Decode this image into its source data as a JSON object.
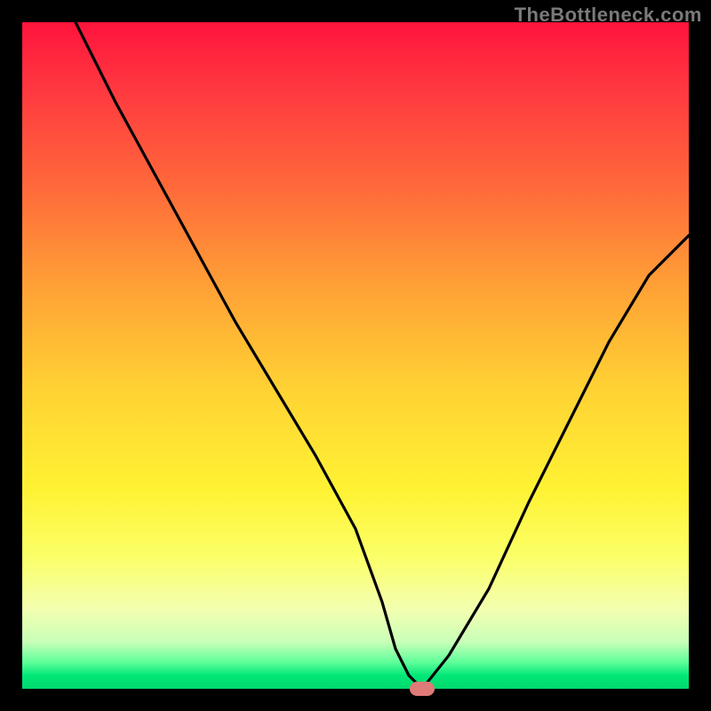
{
  "watermark": "TheBottleneck.com",
  "chart_data": {
    "type": "line",
    "title": "",
    "xlabel": "",
    "ylabel": "",
    "xlim": [
      0,
      100
    ],
    "ylim": [
      0,
      100
    ],
    "background_gradient": {
      "direction": "vertical",
      "stops": [
        {
          "pos": 0,
          "color": "#ff143c"
        },
        {
          "pos": 25,
          "color": "#ff6a3a"
        },
        {
          "pos": 55,
          "color": "#ffd233"
        },
        {
          "pos": 80,
          "color": "#fbff66"
        },
        {
          "pos": 96,
          "color": "#5fff9a"
        },
        {
          "pos": 100,
          "color": "#00d86d"
        }
      ]
    },
    "series": [
      {
        "name": "bottleneck-curve",
        "color": "#000000",
        "x": [
          8,
          14,
          20,
          26,
          32,
          38,
          44,
          50,
          54,
          56,
          58,
          60,
          64,
          70,
          76,
          82,
          88,
          94,
          100
        ],
        "y": [
          100,
          88,
          77,
          66,
          55,
          45,
          35,
          24,
          13,
          6,
          2,
          0,
          5,
          15,
          28,
          40,
          52,
          62,
          68
        ]
      }
    ],
    "marker": {
      "x": 60,
      "y": 0,
      "color": "#de7a78"
    }
  }
}
